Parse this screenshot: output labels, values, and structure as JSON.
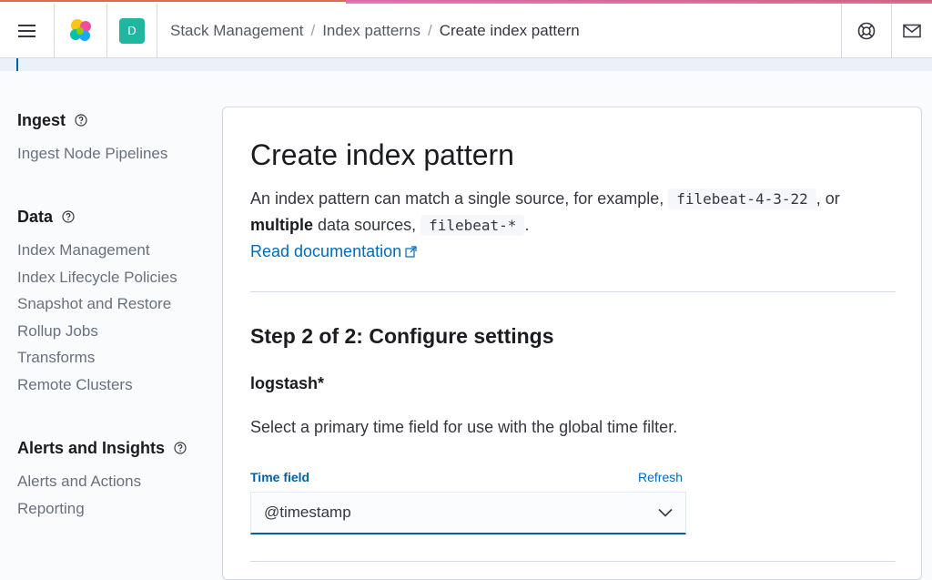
{
  "header": {
    "space_initial": "D",
    "breadcrumbs": [
      "Stack Management",
      "Index patterns"
    ],
    "current_crumb": "Create index pattern"
  },
  "sidebar": {
    "groups": [
      {
        "title": "Ingest",
        "items": [
          "Ingest Node Pipelines"
        ]
      },
      {
        "title": "Data",
        "items": [
          "Index Management",
          "Index Lifecycle Policies",
          "Snapshot and Restore",
          "Rollup Jobs",
          "Transforms",
          "Remote Clusters"
        ]
      },
      {
        "title": "Alerts and Insights",
        "items": [
          "Alerts and Actions",
          "Reporting"
        ]
      }
    ]
  },
  "main": {
    "title": "Create index pattern",
    "desc_part1": "An index pattern can match a single source, for example,",
    "code1": "filebeat-4-3-22",
    "desc_part2": ", or",
    "desc_bold": "multiple",
    "desc_part3": "data sources,",
    "code2": "filebeat-*",
    "desc_part4": ".",
    "doc_link": "Read documentation",
    "step_title": "Step 2 of 2: Configure settings",
    "pattern_name": "logstash*",
    "hint": "Select a primary time field for use with the global time filter.",
    "field_label": "Time field",
    "refresh_label": "Refresh",
    "time_field_value": "@timestamp"
  },
  "colors": {
    "link": "#006bb8",
    "space_avatar": "#20b7a0"
  }
}
